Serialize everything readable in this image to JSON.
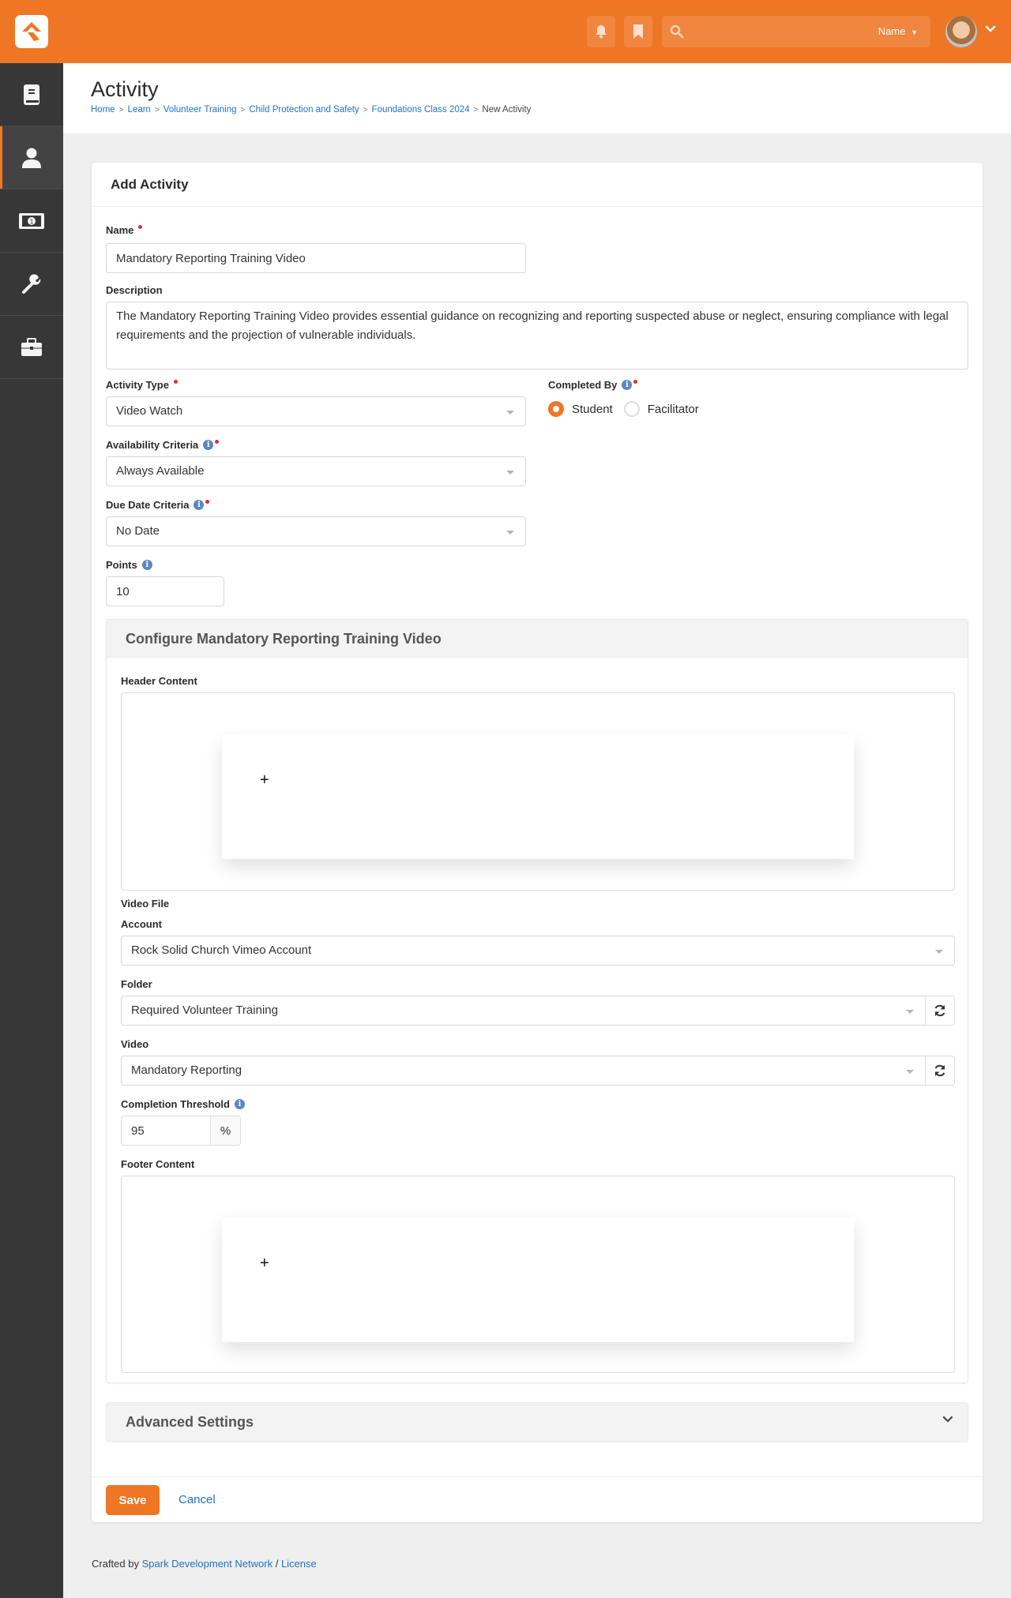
{
  "topbar": {
    "search_placeholder": "",
    "search_scope": "Name",
    "icons": [
      "notifications-bell",
      "bookmark",
      "search"
    ]
  },
  "sidebar": {
    "items": [
      {
        "icon": "book-icon",
        "active": false
      },
      {
        "icon": "person-icon",
        "active": true
      },
      {
        "icon": "money-icon",
        "active": false
      },
      {
        "icon": "wrench-icon",
        "active": false
      },
      {
        "icon": "briefcase-icon",
        "active": false
      }
    ]
  },
  "page": {
    "title": "Activity",
    "breadcrumb": [
      "Home",
      "Learn",
      "Volunteer Training",
      "Child Protection and Safety",
      "Foundations Class 2024"
    ],
    "breadcrumb_current": "New Activity"
  },
  "form": {
    "heading": "Add Activity",
    "name_label": "Name",
    "name_value": "Mandatory Reporting Training Video",
    "description_label": "Description",
    "description_value": "The Mandatory Reporting Training Video provides essential guidance on recognizing and reporting suspected abuse or neglect, ensuring compliance with legal requirements and the projection of vulnerable individuals.",
    "activity_type_label": "Activity Type",
    "activity_type_value": "Video Watch",
    "completed_by_label": "Completed By",
    "completed_by_options": [
      "Student",
      "Facilitator"
    ],
    "completed_by_selected": "Student",
    "availability_label": "Availability Criteria",
    "availability_value": "Always Available",
    "due_date_label": "Due Date Criteria",
    "due_date_value": "No Date",
    "points_label": "Points",
    "points_value": "10"
  },
  "configure": {
    "heading": "Configure Mandatory Reporting Training Video",
    "header_content_label": "Header Content",
    "video_file_label": "Video File",
    "account_label": "Account",
    "account_value": "Rock Solid Church Vimeo Account",
    "folder_label": "Folder",
    "folder_value": "Required Volunteer Training",
    "video_label": "Video",
    "video_value": "Mandatory Reporting",
    "threshold_label": "Completion Threshold",
    "threshold_value": "95",
    "threshold_unit": "%",
    "footer_content_label": "Footer Content",
    "add_symbol": "+"
  },
  "advanced": {
    "title": "Advanced Settings"
  },
  "actions": {
    "save": "Save",
    "cancel": "Cancel"
  },
  "footer": {
    "prefix": "Crafted by",
    "link1": "Spark Development Network",
    "sep": "/",
    "link2": "License"
  },
  "colors": {
    "brand": "#ee7625",
    "link": "#1f73c2",
    "sidebar": "#373737",
    "required": "#d9302c",
    "info": "#5b86c3"
  }
}
